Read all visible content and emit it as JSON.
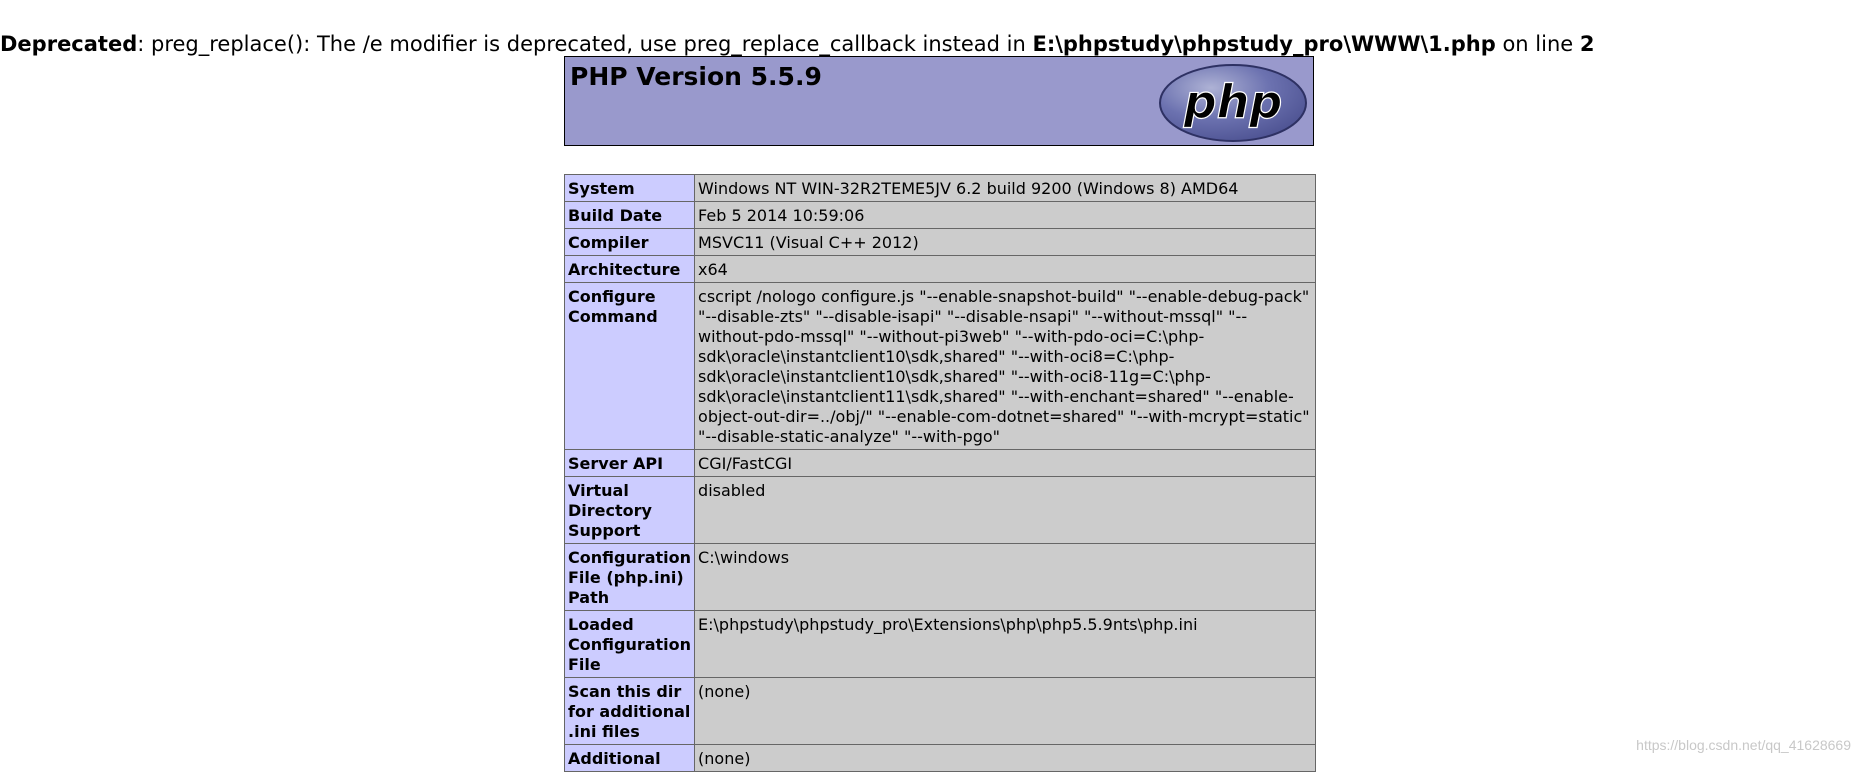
{
  "warning": {
    "label": "Deprecated",
    "message": ": preg_replace(): The /e modifier is deprecated, use preg_replace_callback instead in ",
    "file": "E:\\phpstudy\\phpstudy_pro\\WWW\\1.php",
    "on_line": " on line ",
    "line": "2"
  },
  "header": {
    "title": "PHP Version 5.5.9",
    "logo_text": "php",
    "logo_icon": "php-logo-icon"
  },
  "rows": [
    {
      "key": "System",
      "value": "Windows NT WIN-32R2TEME5JV 6.2 build 9200 (Windows 8) AMD64"
    },
    {
      "key": "Build Date",
      "value": "Feb 5 2014 10:59:06"
    },
    {
      "key": "Compiler",
      "value": "MSVC11 (Visual C++ 2012)"
    },
    {
      "key": "Architecture",
      "value": "x64"
    },
    {
      "key": "Configure Command",
      "value": "cscript /nologo configure.js \"--enable-snapshot-build\" \"--enable-debug-pack\" \"--disable-zts\" \"--disable-isapi\" \"--disable-nsapi\" \"--without-mssql\" \"--without-pdo-mssql\" \"--without-pi3web\" \"--with-pdo-oci=C:\\php-sdk\\oracle\\instantclient10\\sdk,shared\" \"--with-oci8=C:\\php-sdk\\oracle\\instantclient10\\sdk,shared\" \"--with-oci8-11g=C:\\php-sdk\\oracle\\instantclient11\\sdk,shared\" \"--with-enchant=shared\" \"--enable-object-out-dir=../obj/\" \"--enable-com-dotnet=shared\" \"--with-mcrypt=static\" \"--disable-static-analyze\" \"--with-pgo\""
    },
    {
      "key": "Server API",
      "value": "CGI/FastCGI"
    },
    {
      "key": "Virtual Directory Support",
      "value": "disabled"
    },
    {
      "key": "Configuration File (php.ini) Path",
      "value": "C:\\windows"
    },
    {
      "key": "Loaded Configuration File",
      "value": "E:\\phpstudy\\phpstudy_pro\\Extensions\\php\\php5.5.9nts\\php.ini"
    },
    {
      "key": "Scan this dir for additional .ini files",
      "value": "(none)"
    },
    {
      "key": "Additional",
      "value": "(none)"
    }
  ],
  "watermark": "https://blog.csdn.net/qq_41628669"
}
